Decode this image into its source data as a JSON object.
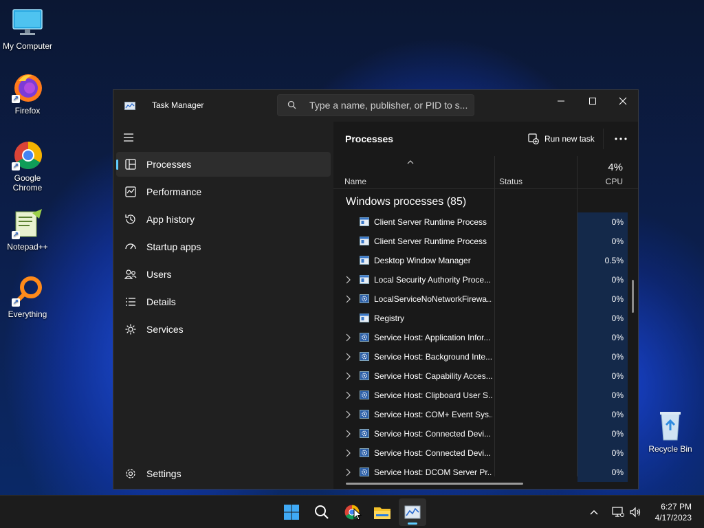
{
  "desktop": {
    "icons": [
      {
        "label": "My Computer"
      },
      {
        "label": "Firefox"
      },
      {
        "label": "Google Chrome"
      },
      {
        "label": "Notepad++"
      },
      {
        "label": "Everything"
      },
      {
        "label": "Recycle Bin"
      }
    ]
  },
  "window": {
    "title": "Task Manager",
    "search_placeholder": "Type a name, publisher, or PID to s..."
  },
  "sidebar": {
    "items": [
      {
        "label": "Processes",
        "icon": "processes-icon",
        "active": true
      },
      {
        "label": "Performance",
        "icon": "performance-icon"
      },
      {
        "label": "App history",
        "icon": "history-icon"
      },
      {
        "label": "Startup apps",
        "icon": "startup-icon"
      },
      {
        "label": "Users",
        "icon": "users-icon"
      },
      {
        "label": "Details",
        "icon": "details-icon"
      },
      {
        "label": "Services",
        "icon": "services-icon"
      }
    ],
    "settings_label": "Settings"
  },
  "main": {
    "title": "Processes",
    "run_task_label": "Run new task",
    "columns": {
      "name": "Name",
      "status": "Status",
      "cpu_percent": "4%",
      "cpu": "CPU"
    },
    "group": "Windows processes (85)",
    "rows": [
      {
        "name": "Client Server Runtime Process",
        "cpu": "0%",
        "expandable": false,
        "icon": "window-icon"
      },
      {
        "name": "Client Server Runtime Process",
        "cpu": "0%",
        "expandable": false,
        "icon": "window-icon"
      },
      {
        "name": "Desktop Window Manager",
        "cpu": "0.5%",
        "expandable": false,
        "icon": "window-icon"
      },
      {
        "name": "Local Security Authority Proce...",
        "cpu": "0%",
        "expandable": true,
        "icon": "window-icon"
      },
      {
        "name": "LocalServiceNoNetworkFirewa...",
        "cpu": "0%",
        "expandable": true,
        "icon": "gear-icon"
      },
      {
        "name": "Registry",
        "cpu": "0%",
        "expandable": false,
        "icon": "window-icon"
      },
      {
        "name": "Service Host: Application Infor...",
        "cpu": "0%",
        "expandable": true,
        "icon": "gear-icon"
      },
      {
        "name": "Service Host: Background Inte...",
        "cpu": "0%",
        "expandable": true,
        "icon": "gear-icon"
      },
      {
        "name": "Service Host: Capability Acces...",
        "cpu": "0%",
        "expandable": true,
        "icon": "gear-icon"
      },
      {
        "name": "Service Host: Clipboard User S...",
        "cpu": "0%",
        "expandable": true,
        "icon": "gear-icon"
      },
      {
        "name": "Service Host: COM+ Event Sys...",
        "cpu": "0%",
        "expandable": true,
        "icon": "gear-icon"
      },
      {
        "name": "Service Host: Connected Devi...",
        "cpu": "0%",
        "expandable": true,
        "icon": "gear-icon"
      },
      {
        "name": "Service Host: Connected Devi...",
        "cpu": "0%",
        "expandable": true,
        "icon": "gear-icon"
      },
      {
        "name": "Service Host: DCOM Server Pr...",
        "cpu": "0%",
        "expandable": true,
        "icon": "gear-icon"
      }
    ]
  },
  "taskbar": {
    "time": "6:27 PM",
    "date": "4/17/2023"
  },
  "colors": {
    "accent": "#60cdff",
    "cpu_cell": "#14294a"
  }
}
